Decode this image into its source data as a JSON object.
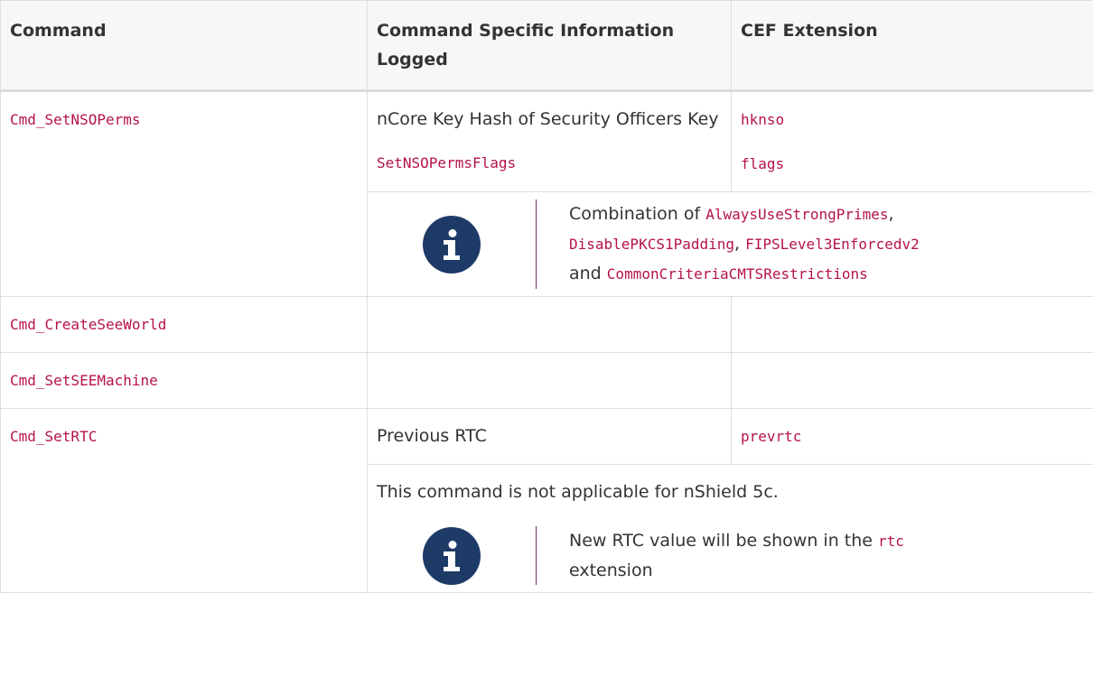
{
  "headers": {
    "command": "Command",
    "info": "Command Specific Information Logged",
    "cef": "CEF Extension"
  },
  "rows": {
    "setnsoperms": {
      "command": "Cmd_SetNSOPerms",
      "info_text": "nCore Key Hash of Security Officers Key",
      "info_code": "SetNSOPermsFlags",
      "cef_1": "hknso",
      "cef_2": "flags",
      "note": {
        "icon": "info-icon",
        "prefix": "Combination of ",
        "code1": "AlwaysUseStrongPrimes",
        "sep1": ", ",
        "code2": "DisablePKCS1Padding",
        "sep2": ", ",
        "code3": "FIPSLevel3Enforcedv2",
        "sep3": " and ",
        "code4": "CommonCriteriaCMTSRestrictions"
      }
    },
    "createseeworld": {
      "command": "Cmd_CreateSeeWorld"
    },
    "setseemachine": {
      "command": "Cmd_SetSEEMachine"
    },
    "setrtc": {
      "command": "Cmd_SetRTC",
      "info_text": "Previous RTC",
      "cef": "prevrtc",
      "extra": "This command is not applicable for nShield 5c.",
      "note": {
        "icon": "info-icon",
        "prefix": "New RTC value will be shown in the ",
        "code": "rtc",
        "suffix": " extension"
      }
    }
  },
  "colors": {
    "code": "#b5124c",
    "icon_bg": "#1e3a67",
    "note_rule": "#6f2e63"
  }
}
